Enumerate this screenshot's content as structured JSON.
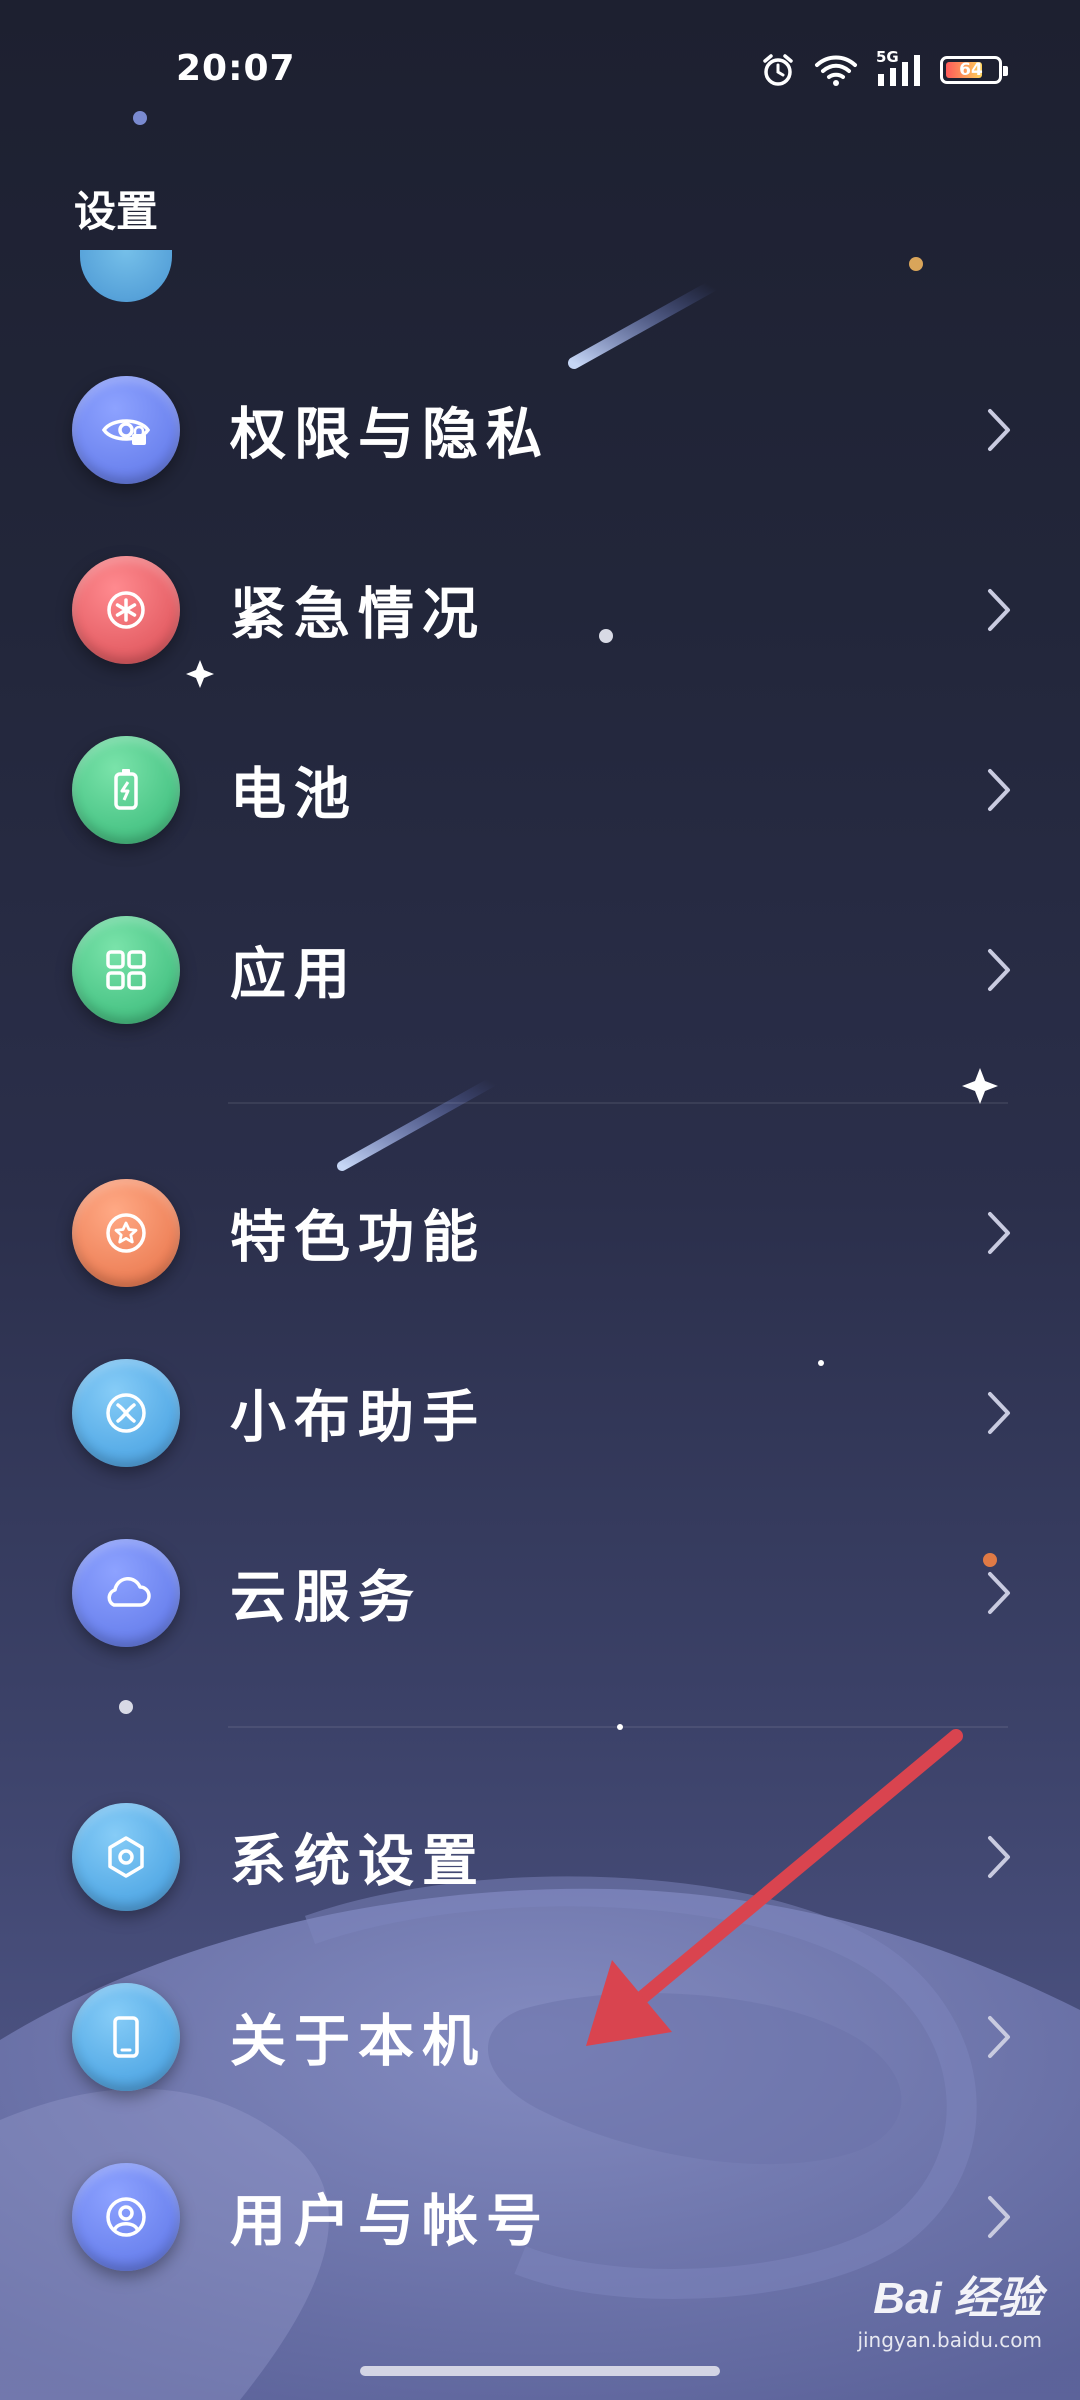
{
  "status_bar": {
    "time": "20:07",
    "network": "5G",
    "battery": "64",
    "icons": [
      "alarm-icon",
      "wifi-icon",
      "cellular-signal-icon",
      "battery-icon"
    ]
  },
  "header": {
    "title": "设置"
  },
  "settings": {
    "items": [
      {
        "label": "权限与隐私",
        "icon": "eye-lock-icon",
        "color": "#6f86f0"
      },
      {
        "label": "紧急情况",
        "icon": "asterisk-icon",
        "color": "#e8646a"
      },
      {
        "label": "电池",
        "icon": "battery-charging-icon",
        "color": "#4fc88a"
      },
      {
        "label": "应用",
        "icon": "apps-grid-icon",
        "color": "#4fc88a"
      },
      {
        "label": "特色功能",
        "icon": "star-badge-icon",
        "color": "#f0865e"
      },
      {
        "label": "小布助手",
        "icon": "assistant-icon",
        "color": "#5aaee8"
      },
      {
        "label": "云服务",
        "icon": "cloud-icon",
        "color": "#6f86f0"
      },
      {
        "label": "系统设置",
        "icon": "hexagon-settings-icon",
        "color": "#5aaee8"
      },
      {
        "label": "关于本机",
        "icon": "phone-icon",
        "color": "#5aaee8"
      },
      {
        "label": "用户与帐号",
        "icon": "user-icon",
        "color": "#6f86f0"
      }
    ]
  },
  "watermark": {
    "brand": "Bai  经验",
    "url": "jingyan.baidu.com"
  },
  "colors": {
    "annotation_arrow": "#d9444f",
    "background_top": "#1d2030",
    "background_bottom": "#5a6198"
  }
}
